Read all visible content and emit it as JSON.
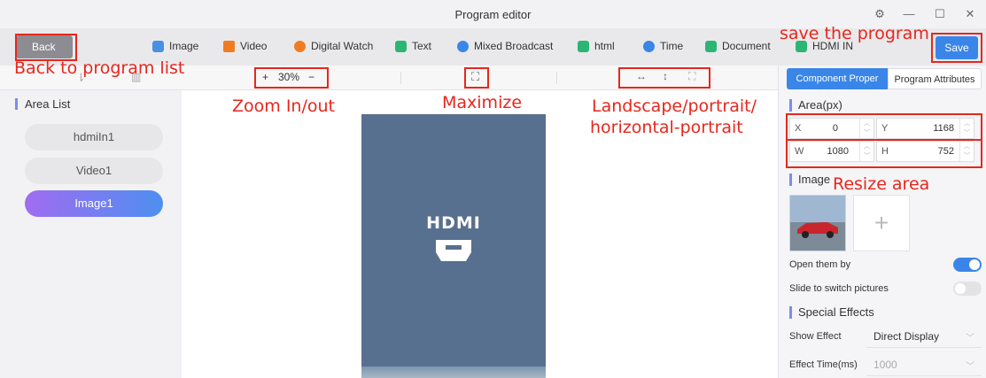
{
  "window": {
    "title": "Program editor",
    "settings_glyph": "⚙",
    "minimize_glyph": "—",
    "maximize_glyph": "☐",
    "close_glyph": "✕"
  },
  "toolbar": {
    "back_label": "Back",
    "save_label": "Save",
    "items": [
      {
        "label": "Image",
        "icon": "image-icon",
        "color": "#4a90e2"
      },
      {
        "label": "Video",
        "icon": "video-icon",
        "color": "#f07c22"
      },
      {
        "label": "Digital Watch",
        "icon": "watch-icon",
        "color": "#f07c22"
      },
      {
        "label": "Text",
        "icon": "text-icon",
        "color": "#2bb673"
      },
      {
        "label": "Mixed Broadcast",
        "icon": "mixed-broadcast-icon",
        "color": "#3a86e8"
      },
      {
        "label": "html",
        "icon": "html-icon",
        "color": "#2bb673"
      },
      {
        "label": "Time",
        "icon": "clock-icon",
        "color": "#3a86e8"
      },
      {
        "label": "Document",
        "icon": "document-icon",
        "color": "#2bb673"
      },
      {
        "label": "HDMI IN",
        "icon": "hdmi-icon",
        "color": "#2bb673"
      }
    ]
  },
  "zoom": {
    "plus": "+",
    "value": "30%",
    "minus": "−"
  },
  "orientation_glyphs": [
    "↔",
    "↕",
    "⛶"
  ],
  "fullscreen_glyph": "⛶",
  "area_list": {
    "title": "Area List",
    "items": [
      "hdmiIn1",
      "Video1",
      "Image1"
    ],
    "active_index": 2
  },
  "preview": {
    "hdmi_text": "HDMI"
  },
  "panel": {
    "tabs": [
      "Component Proper",
      "Program Attributes"
    ],
    "active_tab": 0,
    "area_title": "Area(px)",
    "fields": {
      "x_label": "X",
      "x_value": "0",
      "y_label": "Y",
      "y_value": "1168",
      "w_label": "W",
      "w_value": "1080",
      "h_label": "H",
      "h_value": "752"
    },
    "image_section_title": "Image",
    "add_glyph": "+",
    "open_them_by": {
      "label": "Open them by",
      "on": true
    },
    "slide_switch": {
      "label": "Slide to switch pictures",
      "on": false
    },
    "effects_title": "Special Effects",
    "show_effect": {
      "label": "Show Effect",
      "value": "Direct Display"
    },
    "effect_time": {
      "label": "Effect Time(ms)",
      "value": "1000"
    }
  },
  "annotations": {
    "back": "Back to program list",
    "zoom": "Zoom In/out",
    "maximize": "Maximize",
    "orientation_line1": "Landscape/portrait/",
    "orientation_line2": "horizontal-portrait",
    "save": "save the program",
    "resize": "Resize area"
  },
  "colors": {
    "accent": "#3a86e8",
    "annotation": "#e8261c",
    "screen": "#58708f"
  }
}
